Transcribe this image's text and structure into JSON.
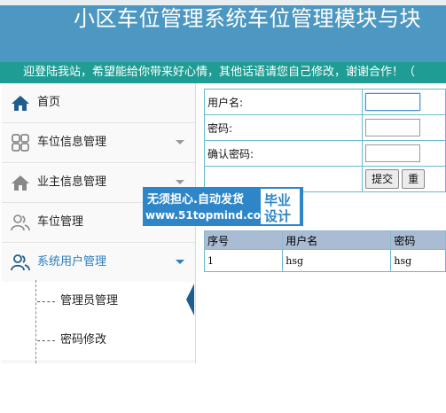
{
  "header": {
    "title": "小区车位管理系统车位管理模块与块"
  },
  "marquee": {
    "text": "迎登陆我站，希望能给你带来好心情，其他话语请您自己修改，谢谢合作！（"
  },
  "sidebar": {
    "items": [
      {
        "label": "首页",
        "icon": "home-icon"
      },
      {
        "label": "车位信息管理",
        "icon": "grid-icon"
      },
      {
        "label": "业主信息管理",
        "icon": "home-icon"
      },
      {
        "label": "车位管理",
        "icon": "users-icon"
      },
      {
        "label": "系统用户管理",
        "icon": "users-icon"
      }
    ],
    "subitems": [
      {
        "label": "管理员管理"
      },
      {
        "label": "密码修改"
      }
    ]
  },
  "form": {
    "username_label": "用户名:",
    "password_label": "密码:",
    "confirm_label": "确认密码:",
    "submit_label": "提交",
    "reset_label": "重"
  },
  "list": {
    "headers": [
      "序号",
      "用户名",
      "密码"
    ],
    "rows": [
      [
        "1",
        "hsg",
        "hsg"
      ]
    ]
  },
  "watermark": {
    "line1": "无须担心.自动发货",
    "line2": "www.51topmind.com",
    "box1": "毕业",
    "box2": "设计"
  },
  "colors": {
    "header": "#4d98c2",
    "marquee": "#1f9d94",
    "accent": "#2b7fbf"
  }
}
